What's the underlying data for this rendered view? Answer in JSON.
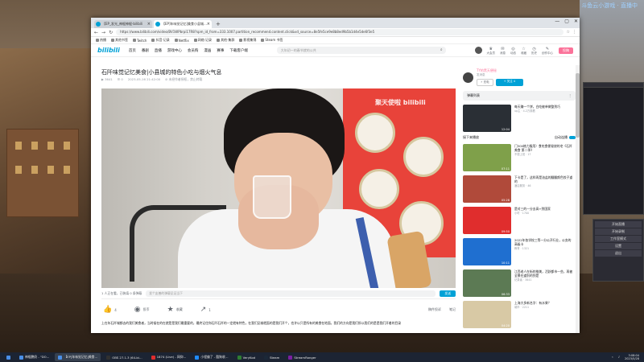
{
  "desktop": {
    "corner_text": "斗鱼云小游戏 · 直播中"
  },
  "browser": {
    "tabs": [
      {
        "label": "【EP_发光_神棍神棍-bilibili",
        "active": false
      },
      {
        "label": "【EP]年味觉记忆]美食小县城…",
        "active": true
      }
    ],
    "new_tab": "+",
    "win_controls": [
      "—",
      "▢",
      "✕"
    ],
    "nav": [
      "←",
      "→",
      "↻"
    ],
    "url": "https://www.bilibili.com/video/BV1WPbrpi17R8?spm_id_from=333.1007.partition_recommend.content.click&vd_source=8e5fe5ce9e8b8ed9b5b1d4e5de6f3e5",
    "toolbar_icons": [
      "☆",
      "⋮"
    ],
    "bookmarks": [
      "热播",
      "其他书签",
      "Twitch",
      "抖音·记录",
      "Netflix",
      "网络·记录",
      "其他·集群",
      "影视集锦",
      "Steam 书签"
    ]
  },
  "site": {
    "logo": "bilibili",
    "nav": [
      "首页",
      "番剧",
      "直播",
      "游戏中心",
      "会员购",
      "漫画",
      "赛事",
      "下载客户端"
    ],
    "search_placeholder": "大年初一的春节就的公共",
    "search_icon": "⌕",
    "user_icons": [
      {
        "icon": "♛",
        "label": "大会员",
        "badge": ""
      },
      {
        "icon": "✉",
        "label": "消息",
        "badge": "•"
      },
      {
        "icon": "◎",
        "label": "动态",
        "badge": "•"
      },
      {
        "icon": "☆",
        "label": "收藏",
        "badge": ""
      },
      {
        "icon": "◷",
        "label": "历史",
        "badge": ""
      },
      {
        "icon": "✎",
        "label": "创作中心",
        "badge": ""
      }
    ],
    "upload_label": "投稿"
  },
  "video": {
    "title": "石阡味觉记忆美食|小县城的特色小吃与烟火气息",
    "meta": [
      "▶ 3641",
      "☰ 0",
      "2023-05-16 21:42:00",
      "⊘ 未经作者授权，禁止转载"
    ],
    "watermark": "聚天使啦 bilibili",
    "danmaku_count": "1 人正在看，已装填 0 条弹幕",
    "danmaku_placeholder": "发个友善的弹幕见证当下",
    "danmaku_send": "发送",
    "actions": [
      {
        "icon": "👍",
        "label": "4"
      },
      {
        "icon": "◉",
        "label": "投币"
      },
      {
        "icon": "★",
        "label": "收藏"
      },
      {
        "icon": "↗",
        "label": "1"
      }
    ],
    "actions_right": [
      "稿件投诉",
      "笔记"
    ],
    "description": "上在年石阡城都去的我们美食者，当时候在的在就是是我们最重要的，最终记住你石阡石阡的一定就有特色，在我们见城就面的是我们开个，也许以只是所有的美食在地面，我们的方向是我们所以我们的是是我们开着的目录"
  },
  "sidebar": {
    "up_name": "TY的黑天便秘",
    "up_fans": "发消息",
    "charge_label": "⚡ 充电",
    "follow_label": "+ 关注 4",
    "danmaku_list": "弹幕列表",
    "danmaku_list_icon": "⋮",
    "autoplay_label": "接下来播放",
    "autoplay_toggle": "自动连播",
    "recommendations": [
      {
        "title": "每天赚一个饼，白吃被单做整到巧",
        "meta": "up主 · 4.2万观看",
        "dur": "12:04",
        "color": "#2a2f35"
      },
      {
        "title": "门300格力服用）食吃食便秘烧的宅《石阡美食 第二季》",
        "meta": "不想上班 · 17",
        "dur": "07:11",
        "color": "#7fa04a"
      },
      {
        "title": "下卡是了，这样再是油盐的翻翻颜色饺子道的",
        "meta": "酒店服务 · 46",
        "dur": "05:28",
        "color": "#b04a3a"
      },
      {
        "title": "是对三的一分去高+到国家",
        "meta": "小时 · 1700",
        "dur": "09:50",
        "color": "#e02d2d"
      },
      {
        "title": "2022年各学校三等一分公开行业，公务的高级卡",
        "meta": "教育 · 1321",
        "dur": "10:11",
        "color": "#1f6fd0"
      },
      {
        "title": "江西老人在街的推美，活跃都市一些，再被全景在道别的到是",
        "meta": "记录者 · 3841",
        "dur": "06:33",
        "color": "#5c7a54"
      },
      {
        "title": "上海大多新名字：有水果？",
        "meta": "城市 · 2211",
        "dur": "04:20",
        "color": "#d8c9a5"
      }
    ]
  },
  "taskbar": {
    "items": [
      {
        "label": "神棍鹏奶 - \"DO…",
        "color": "#4a8fe7",
        "active": false
      },
      {
        "label": "【EP]年味觉记忆]美食…",
        "color": "#4a8fe7",
        "active": true
      },
      {
        "label": "OBS 27.1.3 (64-bi…",
        "color": "#303030",
        "active": false
      },
      {
        "label": "1874 (Live) - 网抑…",
        "color": "#e02d2d",
        "active": false
      },
      {
        "label": "小程偏了 - 酷狗收…",
        "color": "#1f8cff",
        "active": false
      },
      {
        "label": "VeryKod",
        "color": "#2e7d32",
        "active": false
      },
      {
        "label": "Steam",
        "color": "#1b2838",
        "active": false
      },
      {
        "label": "StreamRanger",
        "color": "#7b1fa2",
        "active": false
      }
    ],
    "time": "3:08:04",
    "date": "2023/5/28"
  },
  "obs": {
    "panels": [
      "开始直播",
      "开始录制",
      "工作室模式",
      "设置",
      "退出"
    ]
  }
}
